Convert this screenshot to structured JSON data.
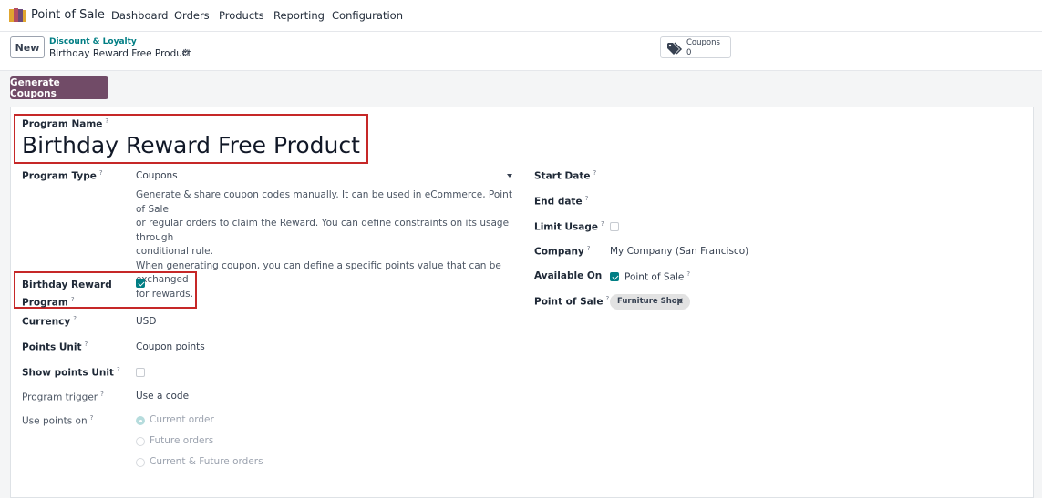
{
  "navbar": {
    "app_name": "Point of Sale",
    "menu": [
      "Dashboard",
      "Orders",
      "Products",
      "Reporting",
      "Configuration"
    ]
  },
  "control": {
    "new_label": "New",
    "breadcrumb": "Discount & Loyalty",
    "record_title": "Birthday Reward Free Product",
    "smart_button": {
      "label": "Coupons",
      "count": "0"
    },
    "generate_label": "Generate Coupons"
  },
  "form": {
    "program_name_label": "Program Name",
    "program_name": "Birthday Reward Free Product",
    "program_type_label": "Program Type",
    "program_type": "Coupons",
    "program_type_help": [
      "Generate & share coupon codes manually. It can be used in eCommerce, Point of Sale",
      "or regular orders to claim the Reward. You can define constraints on its usage through",
      "conditional rule.",
      "When generating coupon, you can define a specific points value that can be exchanged",
      "for rewards."
    ],
    "birthday_label_line1": "Birthday Reward",
    "birthday_label_line2": "Program",
    "birthday_checked": true,
    "currency_label": "Currency",
    "currency": "USD",
    "points_unit_label": "Points Unit",
    "points_unit": "Coupon points",
    "show_points_unit_label": "Show points Unit",
    "show_points_unit": false,
    "program_trigger_label": "Program trigger",
    "program_trigger": "Use a code",
    "use_points_on_label": "Use points on",
    "use_points_options": [
      "Current order",
      "Future orders",
      "Current & Future orders"
    ],
    "use_points_selected": "Current order",
    "start_date_label": "Start Date",
    "end_date_label": "End date",
    "limit_usage_label": "Limit Usage",
    "limit_usage": false,
    "company_label": "Company",
    "company": "My Company (San Francisco)",
    "available_on_label": "Available On",
    "available_on_option": "Point of Sale",
    "available_on_checked": true,
    "pos_label": "Point of Sale",
    "pos_tag": "Furniture Shop",
    "help_mark": "?"
  },
  "colors": {
    "accent": "#714b67",
    "teal": "#017e84",
    "highlight_border": "#c62828"
  }
}
